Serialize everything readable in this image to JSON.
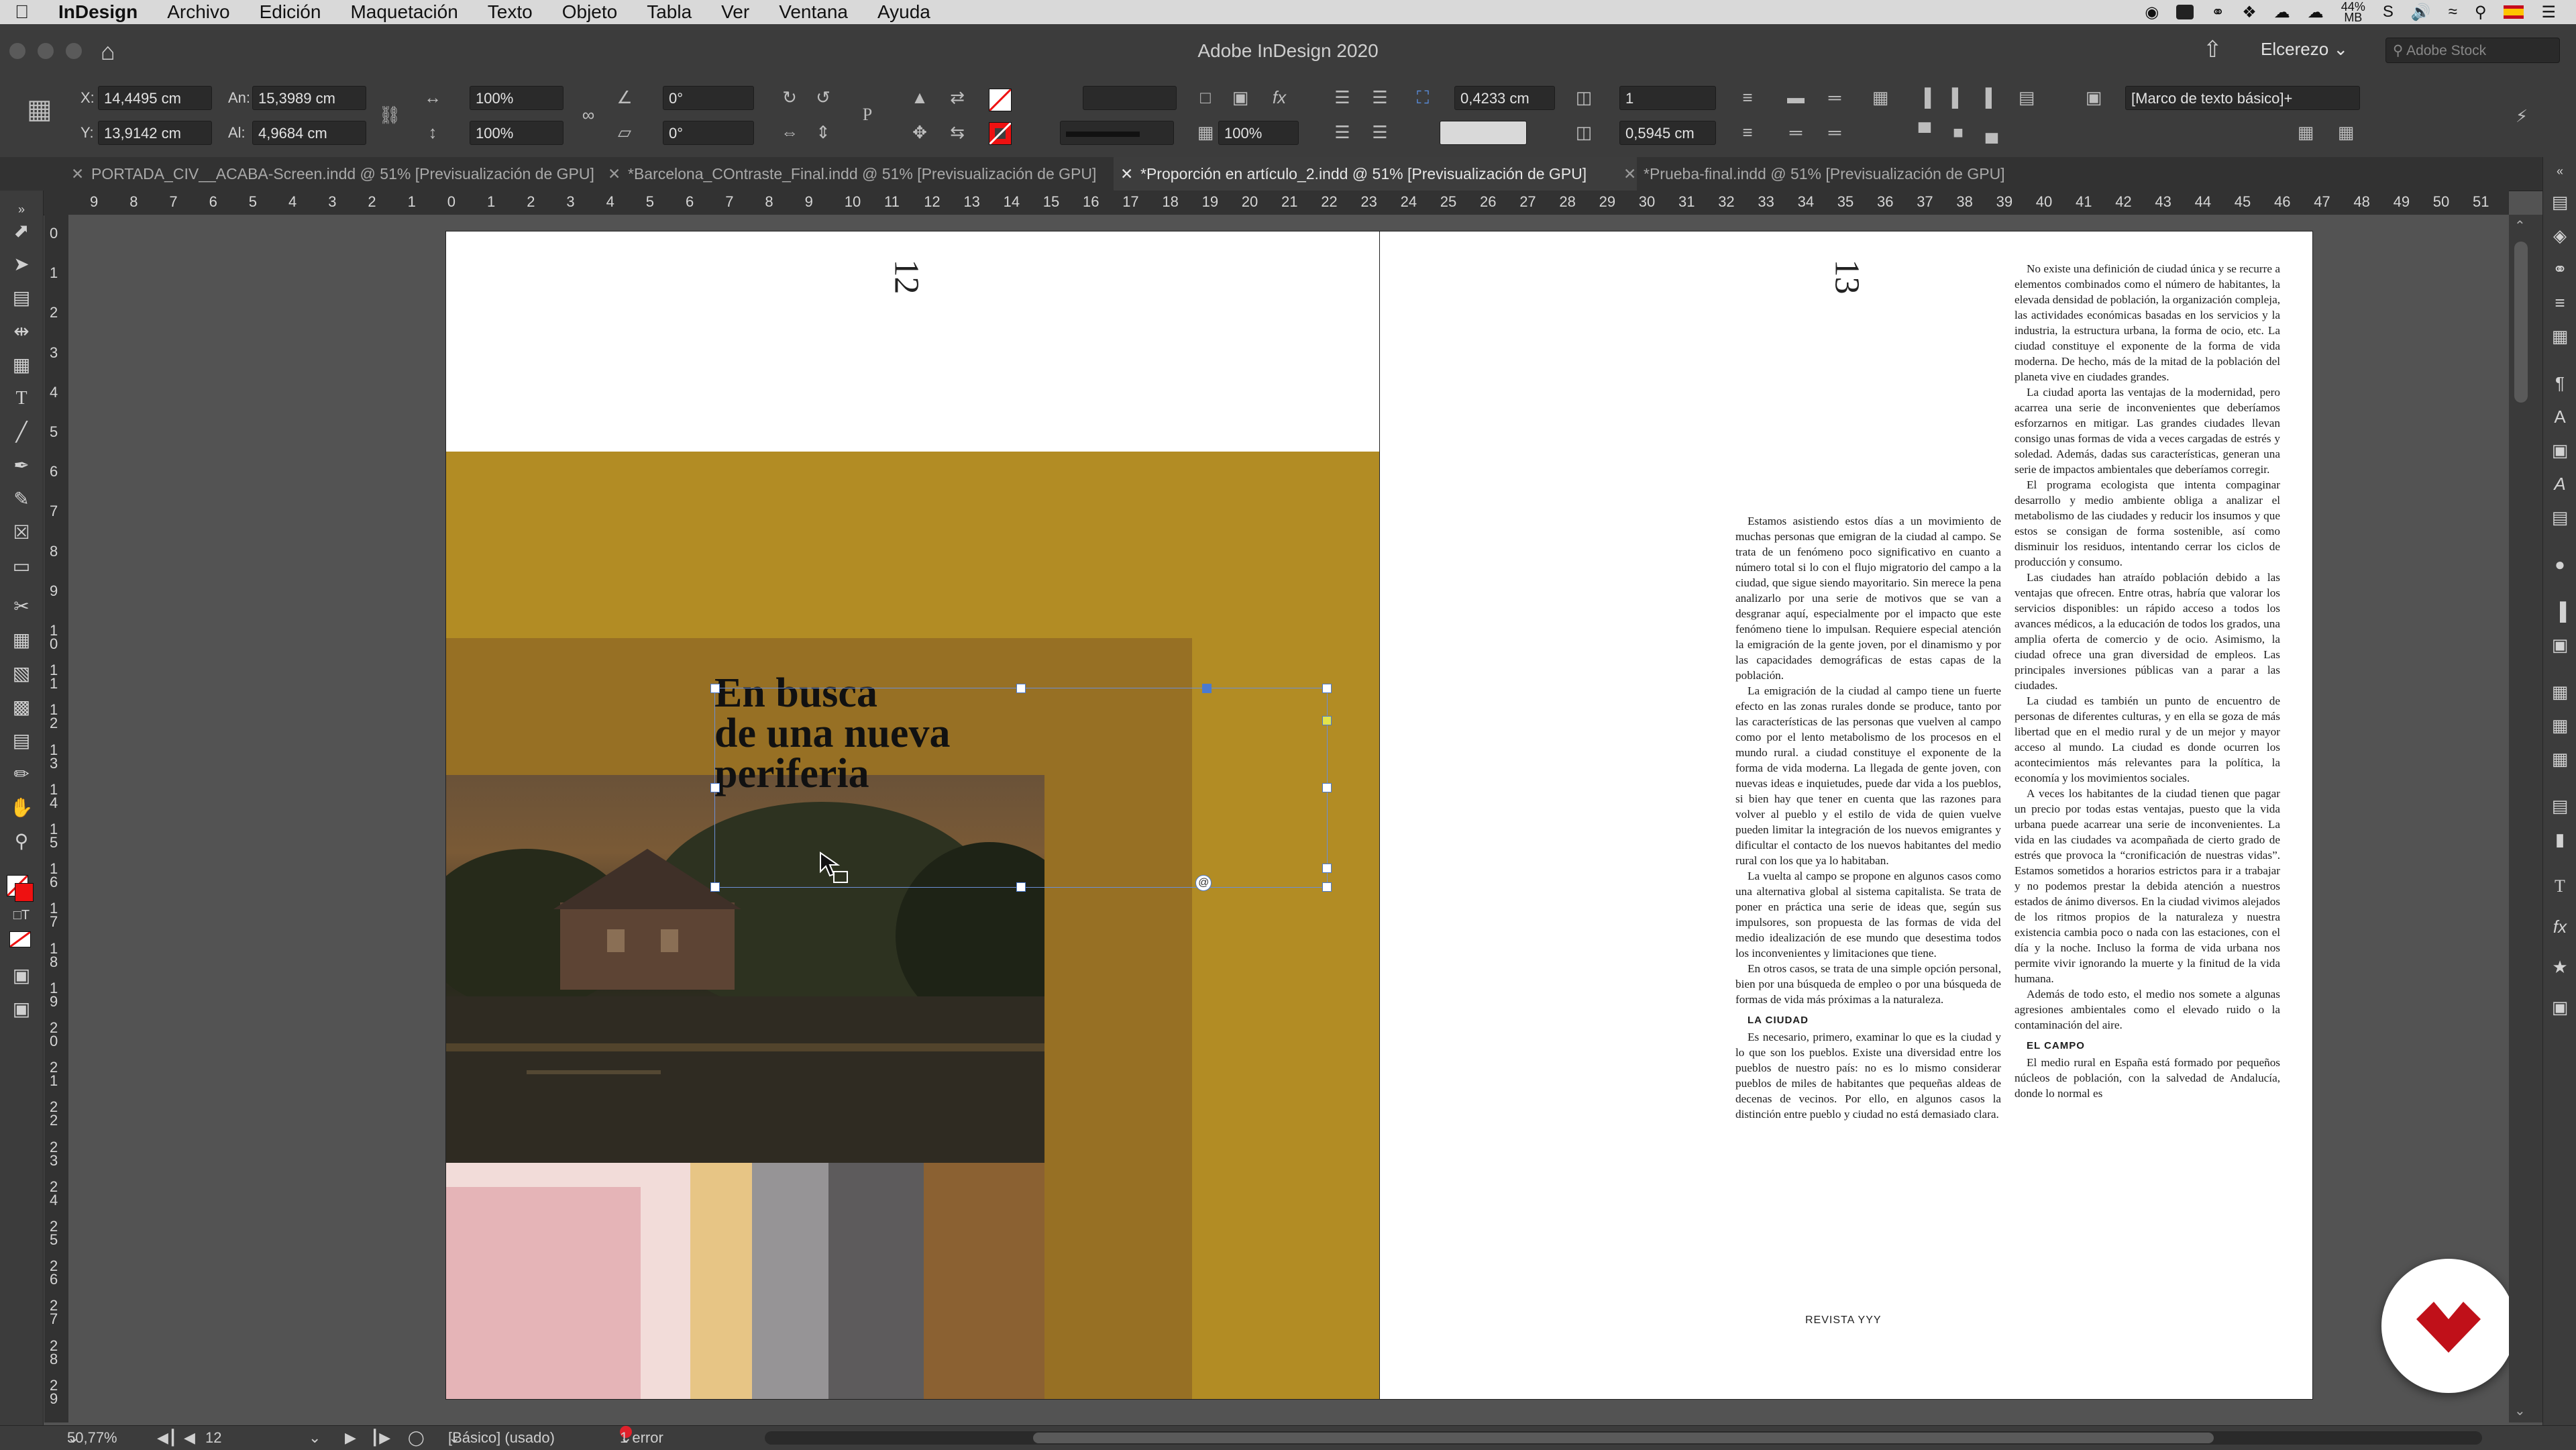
{
  "menubar": {
    "app": "InDesign",
    "items": [
      "Archivo",
      "Edición",
      "Maquetación",
      "Texto",
      "Objeto",
      "Tabla",
      "Ver",
      "Ventana",
      "Ayuda"
    ],
    "battery": "44%",
    "battery_sub": "MB"
  },
  "window": {
    "title": "Adobe InDesign 2020",
    "workspace": "Elcerezo",
    "search_placeholder": "Adobe Stock"
  },
  "control": {
    "x_label": "X:",
    "x_value": "14,4495 cm",
    "y_label": "Y:",
    "y_value": "13,9142 cm",
    "w_label": "An:",
    "w_value": "15,3989 cm",
    "h_label": "Al:",
    "h_value": "4,9684 cm",
    "scale_x": "100%",
    "scale_y": "100%",
    "rotate": "0°",
    "shear": "0°",
    "stroke_weight": "0,4233 cm",
    "columns": "1",
    "gutter": "0,5945 cm",
    "opacity": "100%",
    "style": "[Marco de texto básico]+"
  },
  "tabs": [
    {
      "label": "PORTADA_CIV__ACABA-Screen.indd @ 51% [Previsualización de GPU]",
      "active": false
    },
    {
      "label": "*Barcelona_COntraste_Final.indd @ 51% [Previsualización de GPU]",
      "active": false
    },
    {
      "label": "*Proporción en artículo_2.indd @ 51% [Previsualización de GPU]",
      "active": true
    },
    {
      "label": "*Prueba-final.indd @ 51% [Previsualización de GPU]",
      "active": false
    }
  ],
  "ruler": {
    "h_numbers": [
      "9",
      "8",
      "7",
      "6",
      "5",
      "4",
      "3",
      "2",
      "1",
      "0",
      "1",
      "2",
      "3",
      "4",
      "5",
      "6",
      "7",
      "8",
      "9",
      "10",
      "11",
      "12",
      "13",
      "14",
      "15",
      "16",
      "17",
      "18",
      "19",
      "20",
      "21",
      "22",
      "23",
      "24",
      "25",
      "26",
      "27",
      "28",
      "29",
      "30",
      "31",
      "32",
      "33",
      "34",
      "35",
      "36",
      "37",
      "38",
      "39",
      "40",
      "41",
      "42",
      "43",
      "44",
      "45",
      "46",
      "47",
      "48",
      "49",
      "50",
      "51"
    ],
    "v_numbers": [
      "0",
      "1",
      "2",
      "3",
      "4",
      "5",
      "6",
      "7",
      "8",
      "9",
      "10",
      "11",
      "12",
      "13",
      "14",
      "15",
      "16",
      "17",
      "18",
      "19",
      "20",
      "21",
      "22",
      "23",
      "24",
      "25",
      "26",
      "27",
      "28",
      "29"
    ]
  },
  "document": {
    "left_page_number": "12",
    "right_page_number": "13",
    "headline": [
      "En busca",
      "de una nueva",
      "periferia"
    ],
    "footer": "REVISTA YYY",
    "colors": {
      "mustard": "#b28c24",
      "overlay": "#977024",
      "pink": "#e5b4b7",
      "blush": "#f2dcd9",
      "sand": "#e7c585",
      "gray": "#969496",
      "dark_gray": "#5d5b5c",
      "brown": "#8b6132"
    },
    "column1": [
      {
        "type": "p",
        "text": "Estamos asistiendo estos días a un movimiento de muchas personas que emigran de la ciudad al campo. Se trata de un fenómeno poco significativo en cuanto a número total si lo con el flujo migratorio del campo a la ciudad, que sigue siendo mayoritario. Sin merece la pena analizarlo por una serie de motivos que se van a desgranar aquí, especialmente por el impacto que este fenómeno tiene lo impulsan. Requiere especial atención la emigración de la gente joven, por el dinamismo y por las capacidades demográficas de estas capas de la población."
      },
      {
        "type": "p",
        "text": "La emigración de la ciudad al campo tiene un fuerte efecto en las zonas rurales donde se produce, tanto por las características de las personas que vuelven al campo como por el lento metabolismo de los procesos en el mundo rural. a ciudad constituye el exponente de la forma de vida moderna. La llegada de gente joven, con nuevas ideas e inquietudes, puede dar vida a los pueblos, si bien hay que tener en cuenta que las razones para volver al pueblo y el estilo de vida de quien vuelve pueden limitar la integración de los nuevos emigrantes y dificultar el contacto de los nuevos habitantes del medio rural con los que ya lo habitaban."
      },
      {
        "type": "p",
        "text": "La vuelta al campo se propone en algunos casos como una alternativa global al sistema capitalista. Se trata de poner en práctica una serie de ideas que, según sus impulsores, son propuesta de las formas de vida del medio idealización de ese mundo que desestima todos los inconvenientes y limitaciones que tiene."
      },
      {
        "type": "p",
        "text": "En otros casos, se trata de una simple opción personal, bien por una búsqueda de empleo o por una búsqueda de formas de vida más próximas a la naturaleza."
      },
      {
        "type": "h",
        "text": "LA CIUDAD"
      },
      {
        "type": "p",
        "text": "Es necesario, primero, examinar lo que es la ciudad y lo que son los pueblos. Existe una diversidad entre los pueblos de nuestro país: no es lo mismo considerar pueblos de miles de habitantes que pequeñas aldeas de decenas de vecinos. Por ello, en algunos casos la distinción entre pueblo y ciudad no está demasiado clara."
      }
    ],
    "column2": [
      {
        "type": "p",
        "text": "No existe una definición de ciudad única y se recurre a elementos combinados como el número de habitantes, la elevada densidad de población, la organización compleja, las actividades económicas basadas en los servicios y la industria, la estructura urbana, la forma de ocio, etc. La ciudad constituye el exponente de la forma de vida moderna. De hecho, más de la mitad de la población del planeta vive en ciudades grandes."
      },
      {
        "type": "p",
        "text": "La ciudad aporta las ventajas de la modernidad, pero acarrea una serie de inconvenientes que deberíamos esforzarnos en mitigar. Las grandes ciudades llevan consigo unas formas de vida a veces cargadas de estrés y soledad. Además, dadas sus características, generan una serie de impactos ambientales que deberíamos corregir."
      },
      {
        "type": "p",
        "text": "El programa ecologista que intenta compaginar desarrollo y medio ambiente obliga a analizar el metabolismo de las ciudades y reducir los insumos y que estos se consigan de forma sostenible, así como disminuir los residuos, intentando cerrar los ciclos de producción y consumo."
      },
      {
        "type": "p",
        "text": "Las ciudades han atraído población debido a las ventajas que ofrecen. Entre otras, habría que valorar los servicios disponibles: un rápido acceso a todos los avances médicos, a la educación de todos los grados, una amplia oferta de comercio y de ocio. Asimismo, la ciudad ofrece una gran diversidad de empleos. Las principales inversiones públicas van a parar a las ciudades."
      },
      {
        "type": "p",
        "text": "La ciudad es también un punto de encuentro de personas de diferentes culturas, y en ella se goza de más libertad que en el medio rural y de un mejor y mayor acceso al mundo. La ciudad es donde ocurren los acontecimientos más relevantes para la política, la economía y los movimientos sociales."
      },
      {
        "type": "p",
        "text": "A veces los habitantes de la ciudad tienen que pagar un precio por todas estas ventajas, puesto que la vida urbana puede acarrear una serie de inconvenientes. La vida en las ciudades va acompañada de cierto grado de estrés que provoca la “cronificación de nuestras vidas”. Estamos sometidos a horarios estrictos para ir a trabajar y no podemos prestar la debida atención a nuestros estados de ánimo diversos. En la ciudad vivimos alejados de los ritmos propios de la naturaleza y nuestra existencia cambia poco o nada con las estaciones, con el día y la noche. Incluso la forma de vida urbana nos permite vivir ignorando la muerte y la finitud de la vida humana."
      },
      {
        "type": "p",
        "text": "Además de todo esto, el medio nos somete a algunas agresiones ambientales como el elevado ruido o la contaminación del aire."
      },
      {
        "type": "h",
        "text": "EL CAMPO"
      },
      {
        "type": "p",
        "text": "El medio rural en España está formado por pequeños núcleos de población, con la salvedad de Andalucía, donde lo normal es"
      }
    ]
  },
  "status": {
    "zoom": "50,77%",
    "page": "12",
    "style": "[Básico] (usado)",
    "errors": "1 error"
  }
}
